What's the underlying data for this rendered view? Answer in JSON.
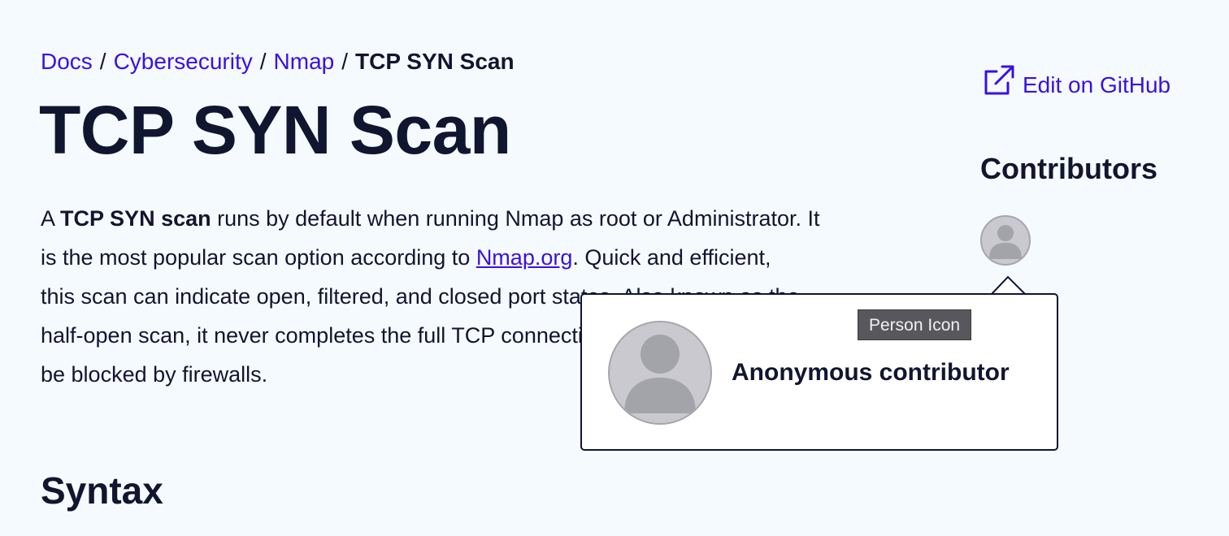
{
  "breadcrumb": {
    "items": [
      "Docs",
      "Cybersecurity",
      "Nmap"
    ],
    "separator": "/",
    "current": "TCP SYN Scan"
  },
  "page_title": "TCP SYN Scan",
  "intro": {
    "line1_prefix": "A ",
    "line1_bold": "TCP SYN scan",
    "line1_suffix": " runs by default when running Nmap as root or Administrator. It",
    "line2_prefix": "is the most popular scan option according to ",
    "line2_link": "Nmap.org",
    "line2_suffix": ". Quick and efficient,",
    "line3": "this scan can indicate open, filtered, and closed port states. Also known as the",
    "line4": "half-open scan, it never completes the full TCP connection and is less likely to",
    "line5": "be blocked by firewalls."
  },
  "syntax_heading": "Syntax",
  "edit_link": {
    "label": "Edit on GitHub",
    "icon": "external-link-icon"
  },
  "contributors": {
    "heading": "Contributors",
    "avatar_icon": "person-icon"
  },
  "popover": {
    "name": "Anonymous contributor",
    "avatar_icon": "person-icon"
  },
  "tooltip": {
    "text": "Person Icon"
  },
  "colors": {
    "background": "#f5faff",
    "text": "#10162f",
    "link": "#3a10e5",
    "avatar_fill": "#c9c9cf",
    "avatar_figure": "#a3a3aa",
    "tooltip_bg": "#58585c"
  }
}
